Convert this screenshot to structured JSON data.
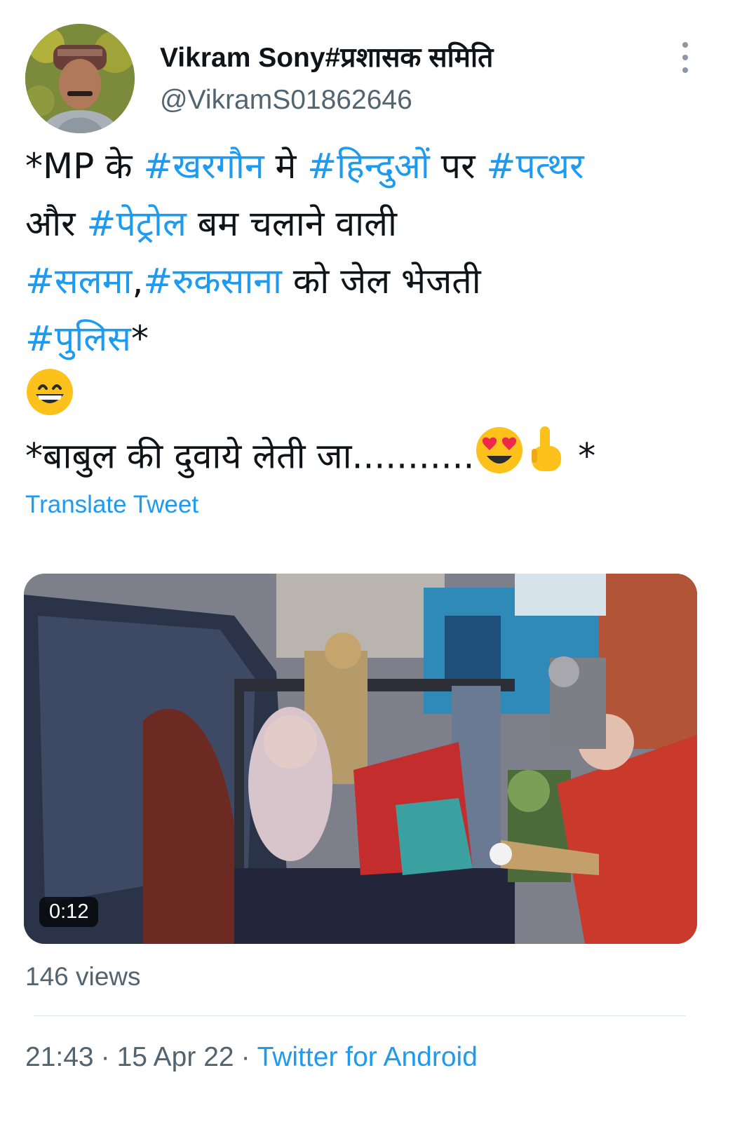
{
  "author": {
    "display_name": "Vikram Sony#प्रशासक समिति",
    "handle": "@VikramS01862646"
  },
  "tweet": {
    "line1": {
      "p1": "*MP के ",
      "t1": "#खरगौन",
      "p2": " मे ",
      "t2": "#हिन्दुओं",
      "p3": " पर ",
      "t3": "#पत्थर"
    },
    "line2": {
      "p1": "और ",
      "t1": "#पेट्रोल",
      "p2": " बम चलाने वाली"
    },
    "line3": {
      "t1": "#सलमा",
      "p1": ",",
      "t2": "#रुकसाना",
      "p2": " को जेल भेजती"
    },
    "line4": {
      "t1": "#पुलिस",
      "p1": "*"
    },
    "line6": {
      "p1": "*बाबुल की दुवाये लेती जा...........",
      "p2": " *"
    },
    "emojis": [
      "grinning-face-with-smiling-eyes",
      "smiling-face-with-heart-eyes",
      "backhand-index-pointing-up"
    ]
  },
  "translate_label": "Translate Tweet",
  "media": {
    "type": "video",
    "duration": "0:12"
  },
  "views": "146 views",
  "meta": {
    "time": "21:43",
    "date": "15 Apr 22",
    "separator": "·",
    "source": "Twitter for Android"
  },
  "colors": {
    "link": "#1d9bf0",
    "secondary": "#536471",
    "text": "#0f1419"
  }
}
